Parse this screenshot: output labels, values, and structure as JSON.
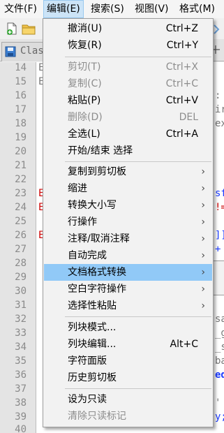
{
  "menubar": {
    "items": [
      "文件(F)",
      "编辑(E)",
      "搜索(S)",
      "视图(V)",
      "格式(M)"
    ]
  },
  "tab": {
    "label": "Clas"
  },
  "gutter": {
    "lines": [
      "14",
      "15",
      "16",
      "17",
      "18",
      "19",
      "20",
      "21",
      "22",
      "23",
      "24",
      "25",
      "26",
      "27",
      "28",
      "29",
      "30",
      "31",
      "32",
      "33",
      "34",
      "35",
      "36",
      "37",
      "38",
      "39",
      "40"
    ]
  },
  "code_fragments": {
    "l14": "E",
    "l15": "E",
    "l23": "E",
    "l24": "E",
    "l26": "E",
    "r16": ":",
    "r17": "ir",
    "r18": "ex",
    "r23": "sf",
    "r24": "!=",
    "r26": "]]",
    "r27": "+",
    "r32": "sa",
    "r33": "_g",
    "r34": "_s",
    "r35": "ba",
    "r36": "ed",
    "r38": "'",
    "r39": "y;"
  },
  "edit_menu": {
    "items": [
      {
        "label": "撤消(U)",
        "shortcut": "Ctrl+Z"
      },
      {
        "label": "恢复(R)",
        "shortcut": "Ctrl+Y"
      },
      {
        "label": "剪切(T)",
        "shortcut": "Ctrl+X"
      },
      {
        "label": "复制(C)",
        "shortcut": "Ctrl+C"
      },
      {
        "label": "粘贴(P)",
        "shortcut": "Ctrl+V"
      },
      {
        "label": "删除(D)",
        "shortcut": "DEL"
      },
      {
        "label": "全选(L)",
        "shortcut": "Ctrl+A"
      },
      {
        "label": "开始/结束 选择",
        "shortcut": ""
      },
      {
        "label": "复制到剪切板",
        "shortcut": ""
      },
      {
        "label": "缩进",
        "shortcut": ""
      },
      {
        "label": "转换大小写",
        "shortcut": ""
      },
      {
        "label": "行操作",
        "shortcut": ""
      },
      {
        "label": "注释/取消注释",
        "shortcut": ""
      },
      {
        "label": "自动完成",
        "shortcut": ""
      },
      {
        "label": "文档格式转换",
        "shortcut": ""
      },
      {
        "label": "空白字符操作",
        "shortcut": ""
      },
      {
        "label": "选择性粘贴",
        "shortcut": ""
      },
      {
        "label": "列块模式...",
        "shortcut": ""
      },
      {
        "label": "列块编辑...",
        "shortcut": "Alt+C"
      },
      {
        "label": "字符面版",
        "shortcut": ""
      },
      {
        "label": "历史剪切板",
        "shortcut": ""
      },
      {
        "label": "设为只读",
        "shortcut": ""
      },
      {
        "label": "清除只读标记",
        "shortcut": ""
      }
    ],
    "submenu_arrow": "›"
  },
  "colors": {
    "highlight": "#91c9f7",
    "code_red": "#cc0000",
    "code_blue": "#1a3aff",
    "code_gray": "#777777"
  }
}
